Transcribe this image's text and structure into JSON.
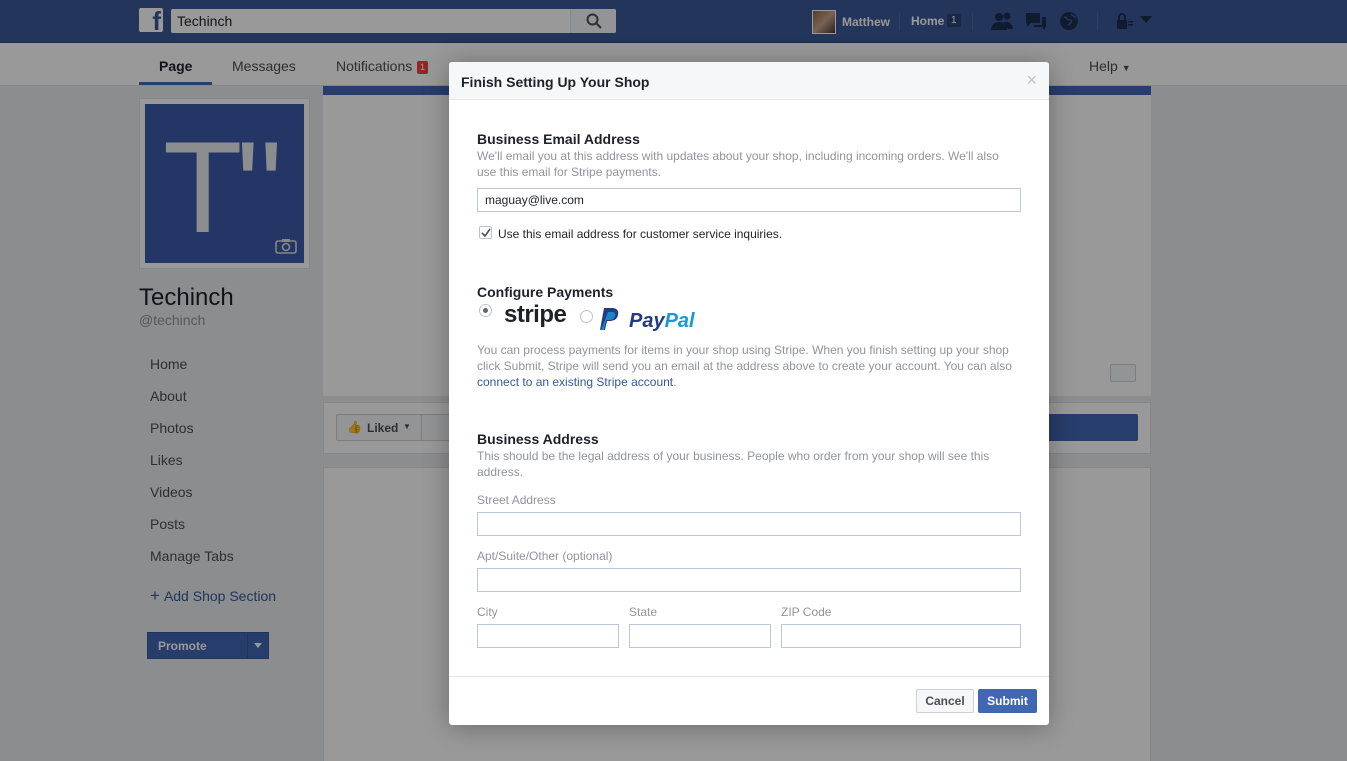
{
  "topbar": {
    "search_value": "Techinch",
    "profile_name": "Matthew",
    "home_label": "Home",
    "home_badge": "1"
  },
  "tabs": {
    "page": "Page",
    "messages": "Messages",
    "notifications": "Notifications",
    "notifications_badge": "1",
    "help": "Help"
  },
  "page": {
    "name": "Techinch",
    "handle": "@techinch",
    "nav": [
      "Home",
      "About",
      "Photos",
      "Likes",
      "Videos",
      "Posts",
      "Manage Tabs"
    ],
    "add_shop": "Add Shop Section",
    "promote": "Promote",
    "liked": "Liked"
  },
  "dialog": {
    "title": "Finish Setting Up Your Shop",
    "close": "×",
    "email": {
      "title": "Business Email Address",
      "help": "We'll email you at this address with updates about your shop, including incoming orders. We'll also use this email for Stripe payments.",
      "value": "maguay@live.com",
      "checkbox_label": "Use this email address for customer service inquiries."
    },
    "payments": {
      "title": "Configure Payments",
      "stripe": "stripe",
      "paypal_a": "Pay",
      "paypal_b": "Pal",
      "help": "You can process payments for items in your shop using Stripe. When you finish setting up your shop click Submit, Stripe will send you an email at the address above to create your account. You can also",
      "link": "connect to an existing Stripe account",
      "after_link": "."
    },
    "address": {
      "title": "Business Address",
      "help": "This should be the legal address of your business. People who order from your shop will see this address.",
      "street_label": "Street Address",
      "apt_label": "Apt/Suite/Other (optional)",
      "city_label": "City",
      "state_label": "State",
      "zip_label": "ZIP Code"
    },
    "cancel": "Cancel",
    "submit": "Submit"
  },
  "colors": {
    "brand": "#3b5998",
    "accent": "#4267b2",
    "link": "#365899"
  }
}
